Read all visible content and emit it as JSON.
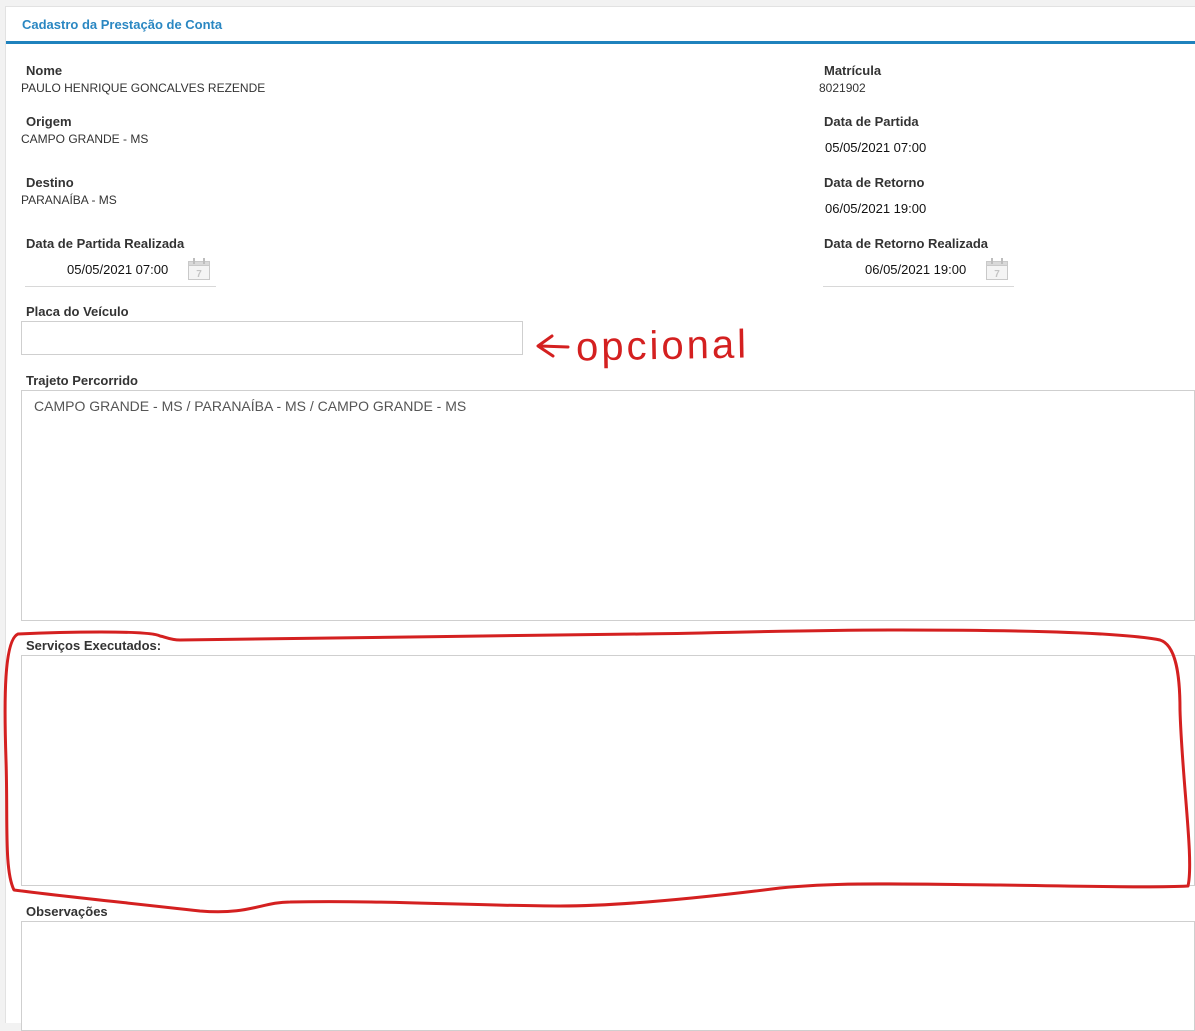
{
  "panel": {
    "title": "Cadastro da Prestação de Conta"
  },
  "fields": {
    "nome": {
      "label": "Nome",
      "value": "PAULO HENRIQUE GONCALVES REZENDE"
    },
    "matricula": {
      "label": "Matrícula",
      "value": "8021902"
    },
    "origem": {
      "label": "Origem",
      "value": "CAMPO GRANDE - MS"
    },
    "data_partida": {
      "label": "Data de Partida",
      "value": "05/05/2021 07:00"
    },
    "destino": {
      "label": "Destino",
      "value": "PARANAÍBA - MS"
    },
    "data_retorno": {
      "label": "Data de Retorno",
      "value": "06/05/2021 19:00"
    },
    "data_partida_realizada": {
      "label": "Data de Partida Realizada",
      "value": "05/05/2021 07:00",
      "icon": "calendar-icon"
    },
    "data_retorno_realizada": {
      "label": "Data de Retorno Realizada",
      "value": "06/05/2021 19:00",
      "icon": "calendar-icon"
    },
    "placa": {
      "label": "Placa do Veículo",
      "value": ""
    },
    "trajeto": {
      "label": "Trajeto Percorrido",
      "value": "CAMPO GRANDE - MS / PARANAÍBA - MS / CAMPO GRANDE - MS"
    },
    "servicos": {
      "label": "Serviços Executados:",
      "value": ""
    },
    "observacoes": {
      "label": "Observações",
      "value": ""
    }
  },
  "annotation": {
    "text": "opcional",
    "color": "#d42020"
  },
  "colors": {
    "accent": "#1f82bd",
    "title": "#2a87c2",
    "annotation": "#d42020"
  }
}
